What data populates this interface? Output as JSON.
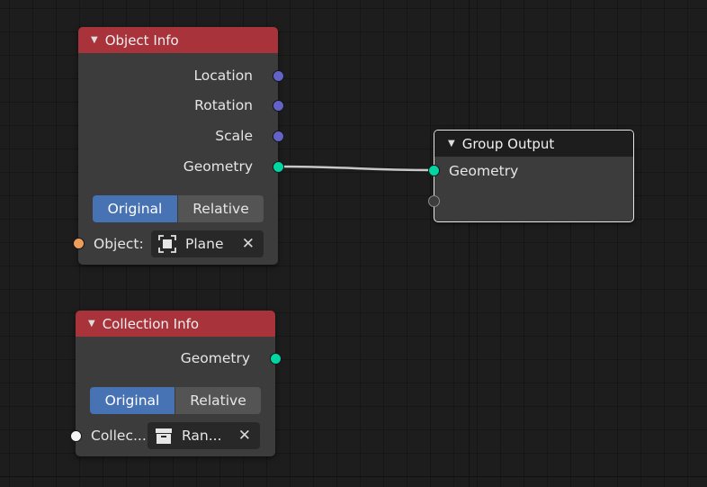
{
  "nodes": {
    "object_info": {
      "title": "Object Info",
      "outputs": [
        "Location",
        "Rotation",
        "Scale",
        "Geometry"
      ],
      "toggle": {
        "original": "Original",
        "relative": "Relative",
        "selected": "Original"
      },
      "object_label": "Object:",
      "object_value": "Plane"
    },
    "group_output": {
      "title": "Group Output",
      "inputs": [
        "Geometry"
      ]
    },
    "collection_info": {
      "title": "Collection Info",
      "outputs": [
        "Geometry"
      ],
      "toggle": {
        "original": "Original",
        "relative": "Relative",
        "selected": "Original"
      },
      "collection_label": "Collec...",
      "collection_value": "Ran..."
    }
  },
  "links": [
    {
      "from": "Object Info.Geometry",
      "to": "Group Output.Geometry"
    }
  ],
  "colors": {
    "header_geometry_input": "#a8333b",
    "header_output": "#1d1d1d",
    "socket_vector": "#6363c7",
    "socket_geometry": "#00d6a3",
    "socket_object": "#ed9e5c",
    "socket_collection": "#f5f5f5",
    "toggle_active": "#4772b3"
  },
  "icons": {
    "collapse": "triangle-down-icon",
    "object": "object-icon",
    "collection": "collection-box-icon",
    "clear": "close-icon"
  }
}
